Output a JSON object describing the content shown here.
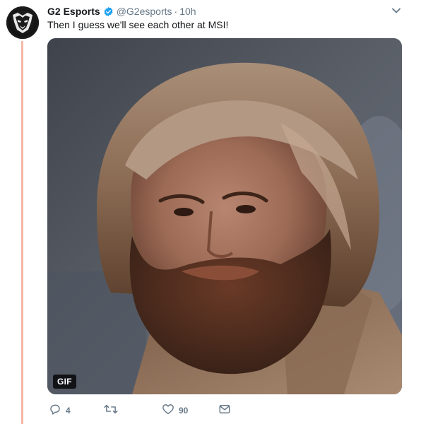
{
  "tweet": {
    "author_name": "G2 Esports",
    "handle": "@G2esports",
    "separator": "·",
    "timestamp": "10h",
    "text": "Then I guess we'll see each other at MSI!",
    "media": {
      "badge": "GIF"
    },
    "actions": {
      "reply_count": "4",
      "retweet_count": "",
      "like_count": "90"
    }
  },
  "icons": {
    "verified": "verified-badge-icon",
    "caret": "chevron-down-icon",
    "reply": "reply-icon",
    "retweet": "retweet-icon",
    "like": "heart-icon",
    "dm": "envelope-icon"
  },
  "colors": {
    "thread_line": "#f5b7a8",
    "verified": "#1da1f2",
    "muted": "#657786"
  }
}
